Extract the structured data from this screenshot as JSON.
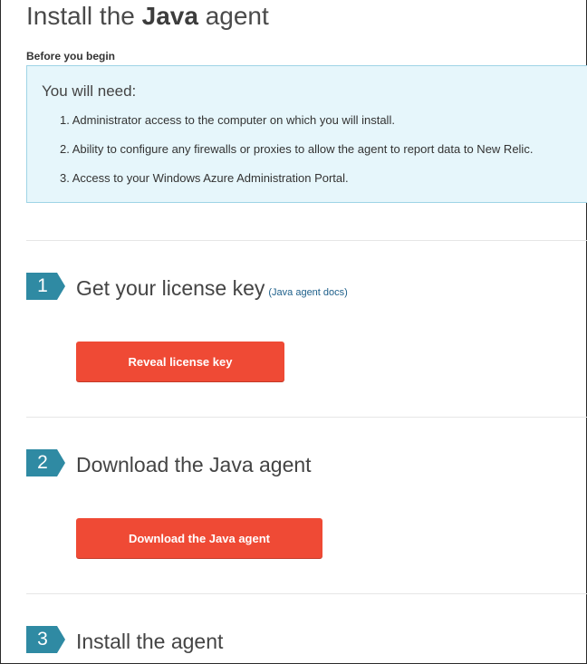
{
  "page": {
    "title_prefix": "Install the ",
    "title_bold": "Java",
    "title_suffix": " agent"
  },
  "before": {
    "heading": "Before you begin",
    "box_title": "You will need:",
    "items": [
      "1. Administrator access to the computer on which you will install.",
      "2. Ability to configure any firewalls or proxies to allow the agent to report data to New Relic.",
      "3. Access to your Windows Azure Administration Portal."
    ]
  },
  "steps": [
    {
      "number": "1",
      "title": "Get your license key",
      "link": "(Java agent docs)",
      "button": "Reveal license key"
    },
    {
      "number": "2",
      "title": "Download the Java agent",
      "button": "Download the Java agent"
    },
    {
      "number": "3",
      "title": "Install the agent"
    }
  ],
  "colors": {
    "accent_button": "#ef4a35",
    "step_badge": "#2f8aa3",
    "info_box": "#e6f6fb"
  }
}
